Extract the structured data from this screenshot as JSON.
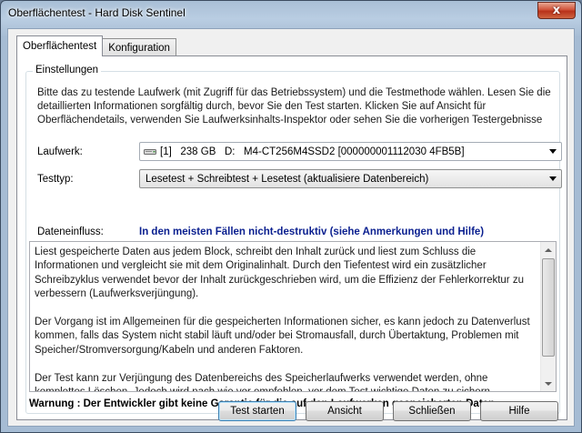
{
  "window": {
    "title": "Oberflächentest - Hard Disk Sentinel",
    "close_label": "x"
  },
  "tabs": [
    {
      "label": "Oberflächentest",
      "active": true
    },
    {
      "label": "Konfiguration",
      "active": false
    }
  ],
  "settings": {
    "group_label": "Einstellungen",
    "intro": "Bitte das zu testende Laufwerk (mit Zugriff für das Betriebssystem) und die Testmethode wählen. Lesen Sie die detaillierten Informationen sorgfältig durch, bevor Sie den Test starten. Klicken Sie auf Ansicht für Oberflächendetails, verwenden Sie Laufwerksinhalts-Inspektor oder sehen Sie die vorherigen Testergebnisse",
    "drive_label": "Laufwerk:",
    "drive_value": "[1]   238 GB   D:   M4-CT256M4SSD2 [000000001112030 4FB5B]",
    "test_type_label": "Testtyp:",
    "test_type_value": "Lesetest + Schreibtest + Lesetest (aktualisiere Datenbereich)",
    "data_impact_label": "Dateneinfluss:",
    "data_impact_value": "In den meisten Fällen nicht-destruktiv (siehe Anmerkungen und Hilfe)",
    "description": [
      "Liest gespeicherte Daten aus jedem Block, schreibt den Inhalt zurück und liest zum Schluss die Informationen und vergleicht sie mit dem Originalinhalt. Durch den Tiefentest wird ein zusätzlicher Schreibzyklus verwendet bevor der Inhalt zurückgeschrieben wird, um die Effizienz der Fehlerkorrektur zu verbessern (Laufwerksverjüngung).",
      "Der Vorgang ist im Allgemeinen für die gespeicherten Informationen sicher, es kann jedoch zu Datenverlust kommen, falls das System nicht stabil läuft und/oder bei Stromausfall, durch Übertaktung, Problemen mit Speicher/Stromversorgung/Kabeln und anderen Faktoren.",
      "Der Test kann zur Verjüngung des Datenbereichs des Speicherlaufwerks verwendet werden, ohne komplettes Löschen. Jedoch wird nach wie vor empfohlen, vor dem Test wichtige Daten zu sichern."
    ],
    "warning": "Warnung : Der Entwickler gibt keine Garantie für die auf den Laufwerken gespeicherten Daten."
  },
  "buttons": {
    "start": "Test starten",
    "view": "Ansicht",
    "close": "Schließen",
    "help": "Hilfe"
  },
  "colors": {
    "data_impact": "#0a1f8f",
    "close_button": "#c8462c"
  },
  "icons": {
    "drive": "drive-icon"
  }
}
